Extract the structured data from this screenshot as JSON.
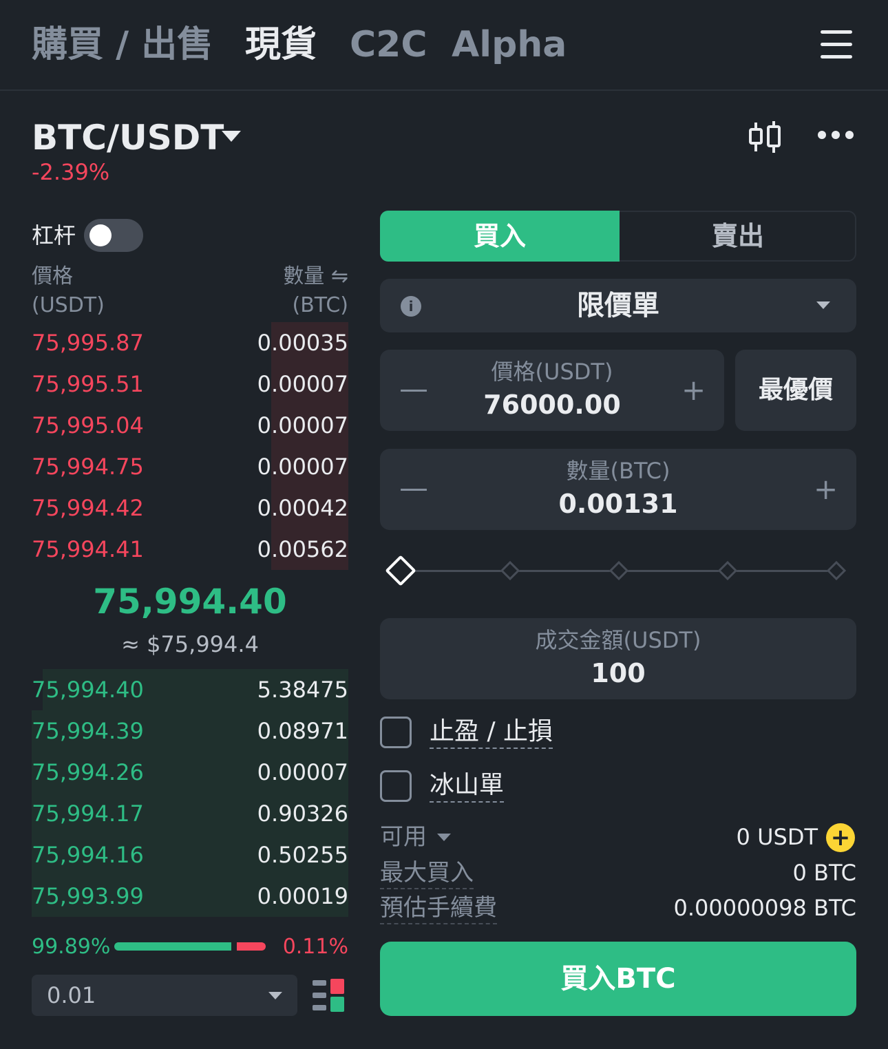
{
  "nav": {
    "tabs": [
      {
        "label": "購買 / 出售",
        "active": false
      },
      {
        "label": "現貨",
        "active": true
      },
      {
        "label": "C2C",
        "active": false
      },
      {
        "label": "Alpha",
        "active": false
      }
    ]
  },
  "market": {
    "pair": "BTC/USDT",
    "change": "-2.39%"
  },
  "orderbook": {
    "leverage_label": "杠杆",
    "price_header": "價格",
    "price_unit": "(USDT)",
    "qty_header": "數量 ⇋",
    "qty_unit": "(BTC)",
    "asks": [
      {
        "price": "75,995.87",
        "qty": "0.00035"
      },
      {
        "price": "75,995.51",
        "qty": "0.00007"
      },
      {
        "price": "75,995.04",
        "qty": "0.00007"
      },
      {
        "price": "75,994.75",
        "qty": "0.00007"
      },
      {
        "price": "75,994.42",
        "qty": "0.00042"
      },
      {
        "price": "75,994.41",
        "qty": "0.00562"
      }
    ],
    "last_price": "75,994.40",
    "last_price_usd": "≈ $75,994.4",
    "bids": [
      {
        "price": "75,994.40",
        "qty": "5.38475"
      },
      {
        "price": "75,994.39",
        "qty": "0.08971"
      },
      {
        "price": "75,994.26",
        "qty": "0.00007"
      },
      {
        "price": "75,994.17",
        "qty": "0.90326"
      },
      {
        "price": "75,994.16",
        "qty": "0.50255"
      },
      {
        "price": "75,993.99",
        "qty": "0.00019"
      }
    ],
    "buy_ratio": "99.89%",
    "sell_ratio": "0.11%",
    "precision": "0.01"
  },
  "form": {
    "buy_tab": "買入",
    "sell_tab": "賣出",
    "order_type": "限價單",
    "price_label": "價格(USDT)",
    "price_value": "76000.00",
    "best_price": "最優價",
    "qty_label": "數量(BTC)",
    "qty_value": "0.00131",
    "total_label": "成交金額(USDT)",
    "total_value": "100",
    "tp_sl_label": "止盈 / 止損",
    "iceberg_label": "冰山單",
    "available_label": "可用",
    "available_value": "0 USDT",
    "max_buy_label": "最大買入",
    "max_buy_value": "0 BTC",
    "fee_label": "預估手續費",
    "fee_value": "0.00000098 BTC",
    "submit_label": "買入BTC"
  },
  "colors": {
    "buy": "#2ebd85",
    "sell": "#f6465d",
    "background": "#1e2329",
    "panel": "#2b3139",
    "accent": "#fcd535"
  }
}
